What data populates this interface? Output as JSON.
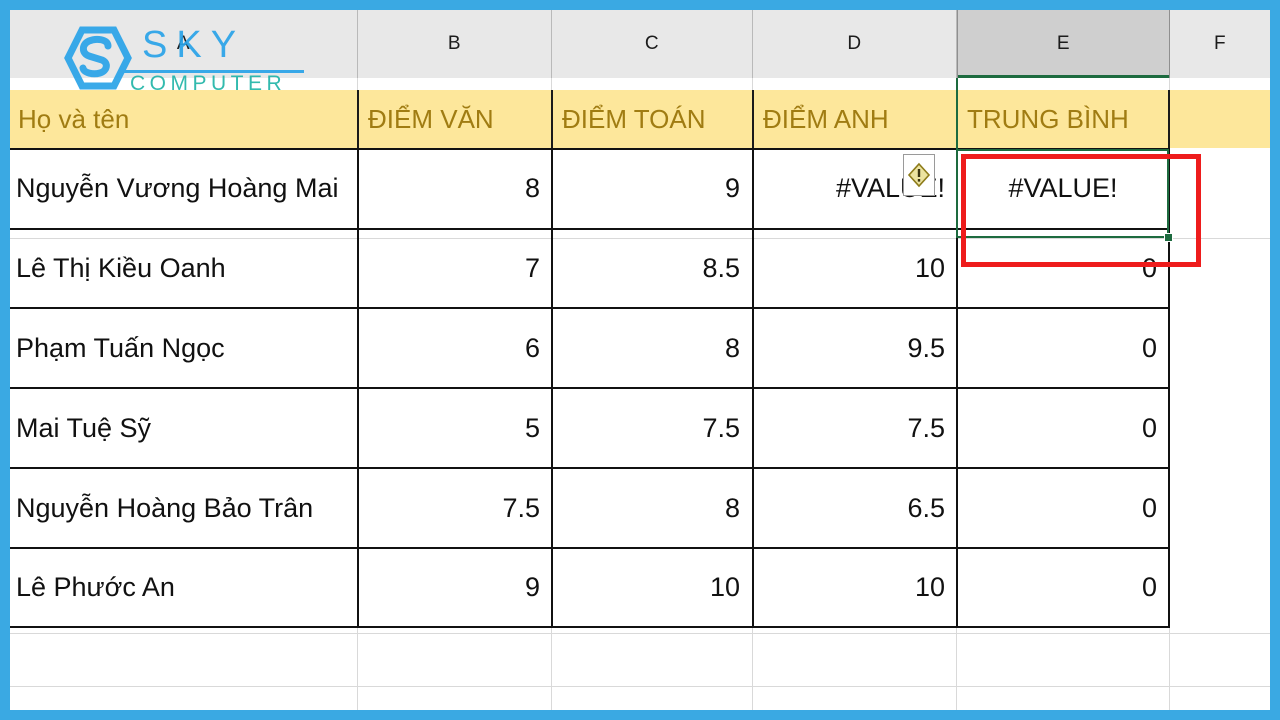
{
  "app": {
    "name": "excel-spreadsheet",
    "frame_color": "#3aa9e3"
  },
  "watermark": {
    "brand_top": "SKY",
    "brand_bottom": "COMPUTER",
    "mark": "hexagon-s-logo",
    "color_top": "#2aa3e8",
    "color_bottom": "#21b5a8"
  },
  "column_headers": [
    {
      "letter": "A",
      "active": false
    },
    {
      "letter": "B",
      "active": false
    },
    {
      "letter": "C",
      "active": false
    },
    {
      "letter": "D",
      "active": false
    },
    {
      "letter": "E",
      "active": true
    },
    {
      "letter": "F",
      "active": false
    }
  ],
  "table": {
    "header_fill": "#fde79b",
    "header_text_color": "#a07c12",
    "headers": [
      "Họ và tên",
      "ĐIỂM VĂN",
      "ĐIỂM TOÁN",
      "ĐIỂM ANH",
      "TRUNG BÌNH"
    ],
    "rows": [
      {
        "name": "Nguyễn Vương Hoàng Mai",
        "van": "8",
        "toan": "9",
        "anh": "#VALUE!",
        "tb": "#VALUE!"
      },
      {
        "name": "Lê Thị Kiều Oanh",
        "van": "7",
        "toan": "8.5",
        "anh": "10",
        "tb": "0"
      },
      {
        "name": "Phạm Tuấn Ngọc",
        "van": "6",
        "toan": "8",
        "anh": "9.5",
        "tb": "0"
      },
      {
        "name": "Mai Tuệ Sỹ",
        "van": "5",
        "toan": "7.5",
        "anh": "7.5",
        "tb": "0"
      },
      {
        "name": "Nguyễn Hoàng Bảo Trân",
        "van": "7.5",
        "toan": "8",
        "anh": "6.5",
        "tb": "0"
      },
      {
        "name": "Lê Phước An",
        "van": "9",
        "toan": "10",
        "anh": "10",
        "tb": "0"
      }
    ]
  },
  "error_indicator": {
    "icon": "warning-diamond-icon",
    "glyph": "!",
    "cell": "D2",
    "fill": "#ece3a0",
    "stroke": "#8d7b1a"
  },
  "selection": {
    "cell": "E2",
    "value": "#VALUE!",
    "border_color": "#1d6b3f",
    "fill_handle": "fill-handle"
  },
  "annotation": {
    "shape": "rectangle",
    "color": "#ee1c1c",
    "target_cell": "E2"
  }
}
